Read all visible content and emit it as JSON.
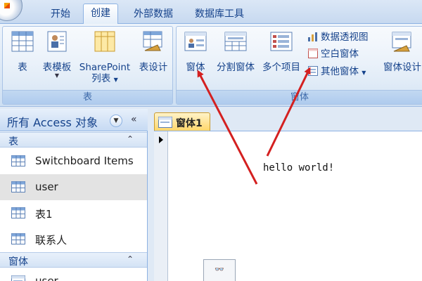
{
  "tabs": [
    {
      "label": "开始"
    },
    {
      "label": "创建"
    },
    {
      "label": "外部数据"
    },
    {
      "label": "数据库工具"
    }
  ],
  "ribbon": {
    "tables_group": {
      "label": "表",
      "buttons": [
        {
          "label": "表"
        },
        {
          "label": "表模板"
        },
        {
          "label": "SharePoint 列表"
        },
        {
          "label": "表设计"
        }
      ],
      "sharepoint_line1": "SharePoint",
      "sharepoint_line2": "列表"
    },
    "forms_group": {
      "label": "窗体",
      "form": "窗体",
      "split_form": "分割窗体",
      "multiple_items": "多个项目",
      "pivot_chart": "数据透视图",
      "blank_form": "空白窗体",
      "more_forms": "其他窗体",
      "form_design": "窗体设计"
    }
  },
  "nav": {
    "title": "所有 Access 对象",
    "sections": [
      {
        "title": "表",
        "items": [
          "Switchboard Items",
          "user",
          "表1",
          "联系人"
        ]
      },
      {
        "title": "窗体",
        "items": [
          "user"
        ]
      }
    ]
  },
  "document": {
    "tab_label": "窗体1",
    "content_text": "hello world!"
  },
  "colors": {
    "ribbon_text": "#15428b",
    "active_doc_tab": "#ffd66b",
    "annotation_arrow": "#d42020"
  }
}
